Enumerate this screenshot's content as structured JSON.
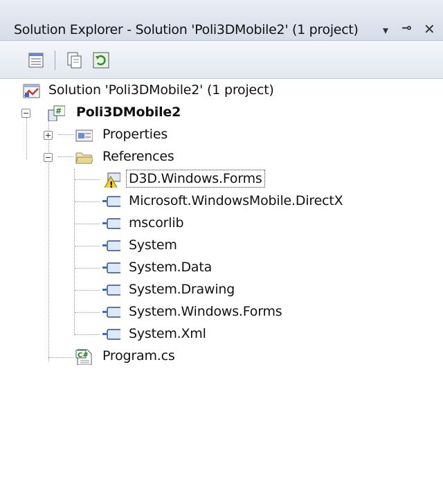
{
  "window": {
    "title": "Solution Explorer - Solution 'Poli3DMobile2' (1 project)",
    "controls": {
      "dropdown": "▾",
      "pin": "⊸",
      "close": "✕"
    }
  },
  "toolbar": {
    "buttons": [
      {
        "name": "properties-icon"
      },
      {
        "name": "show-all-files-icon"
      },
      {
        "name": "refresh-icon"
      }
    ]
  },
  "tree": {
    "solution": "Solution 'Poli3DMobile2' (1 project)",
    "project": "Poli3DMobile2",
    "properties": "Properties",
    "references": "References",
    "reference_items": [
      "D3D.Windows.Forms",
      "Microsoft.WindowsMobile.DirectX",
      "mscorlib",
      "System",
      "System.Data",
      "System.Drawing",
      "System.Windows.Forms",
      "System.Xml"
    ],
    "program": "Program.cs"
  }
}
